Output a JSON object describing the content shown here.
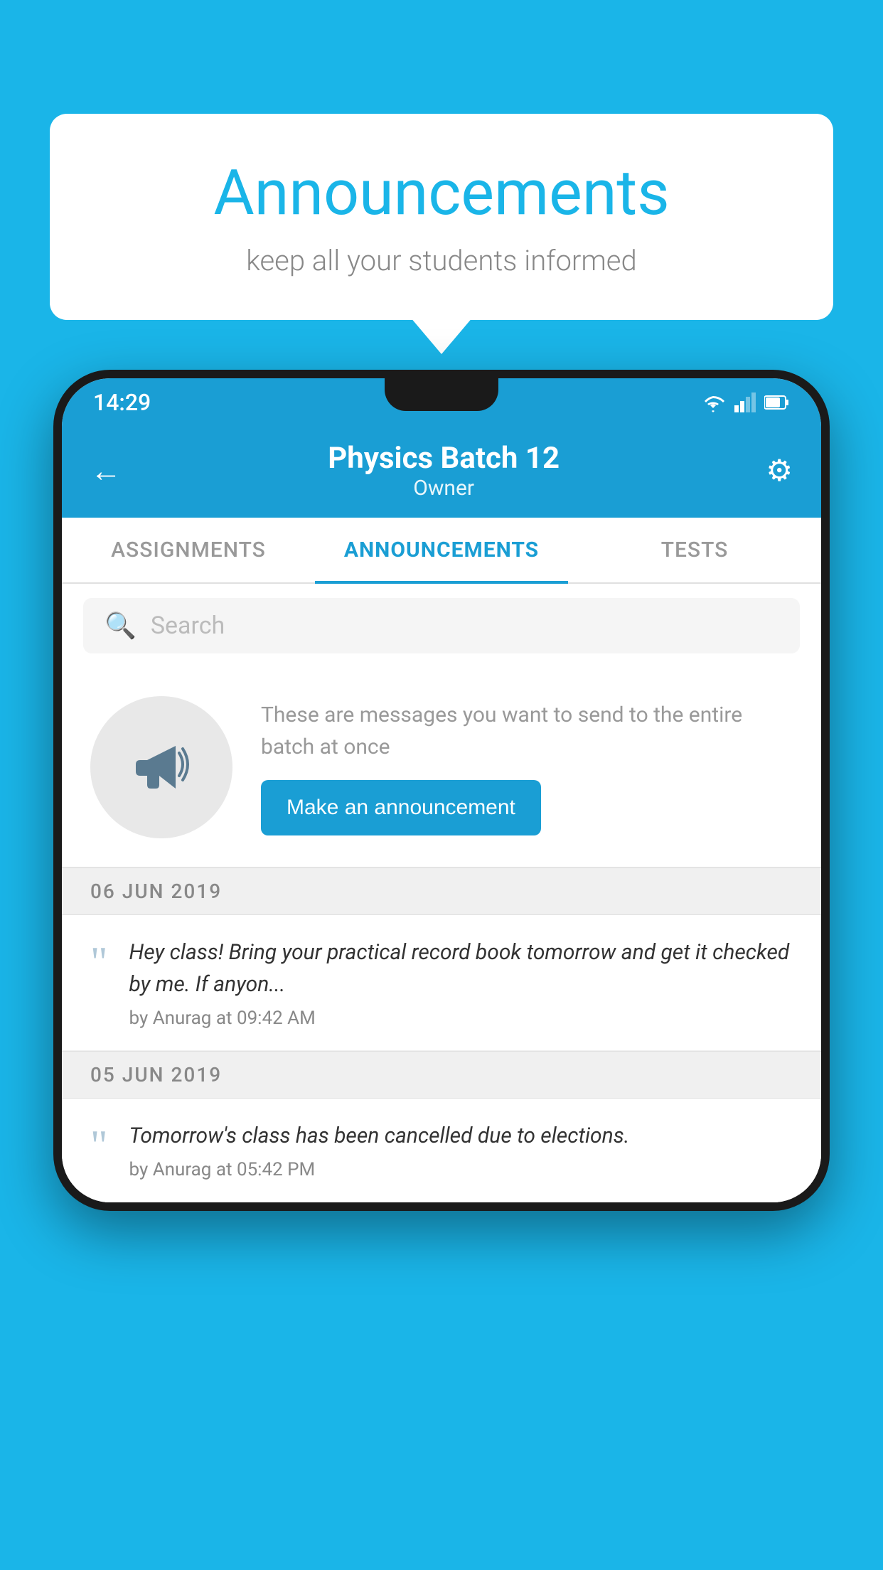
{
  "background_color": "#1ab5e8",
  "speech_bubble": {
    "title": "Announcements",
    "subtitle": "keep all your students informed"
  },
  "phone": {
    "status_bar": {
      "time": "14:29"
    },
    "header": {
      "title": "Physics Batch 12",
      "subtitle": "Owner",
      "back_label": "←",
      "gear_label": "⚙"
    },
    "tabs": [
      {
        "label": "ASSIGNMENTS",
        "active": false
      },
      {
        "label": "ANNOUNCEMENTS",
        "active": true
      },
      {
        "label": "TESTS",
        "active": false
      }
    ],
    "search": {
      "placeholder": "Search"
    },
    "promo": {
      "description": "These are messages you want to send to the entire batch at once",
      "button_label": "Make an announcement"
    },
    "announcements": [
      {
        "date": "06  JUN  2019",
        "text": "Hey class! Bring your practical record book tomorrow and get it checked by me. If anyon...",
        "author": "by Anurag at 09:42 AM"
      },
      {
        "date": "05  JUN  2019",
        "text": "Tomorrow's class has been cancelled due to elections.",
        "author": "by Anurag at 05:42 PM"
      }
    ]
  }
}
